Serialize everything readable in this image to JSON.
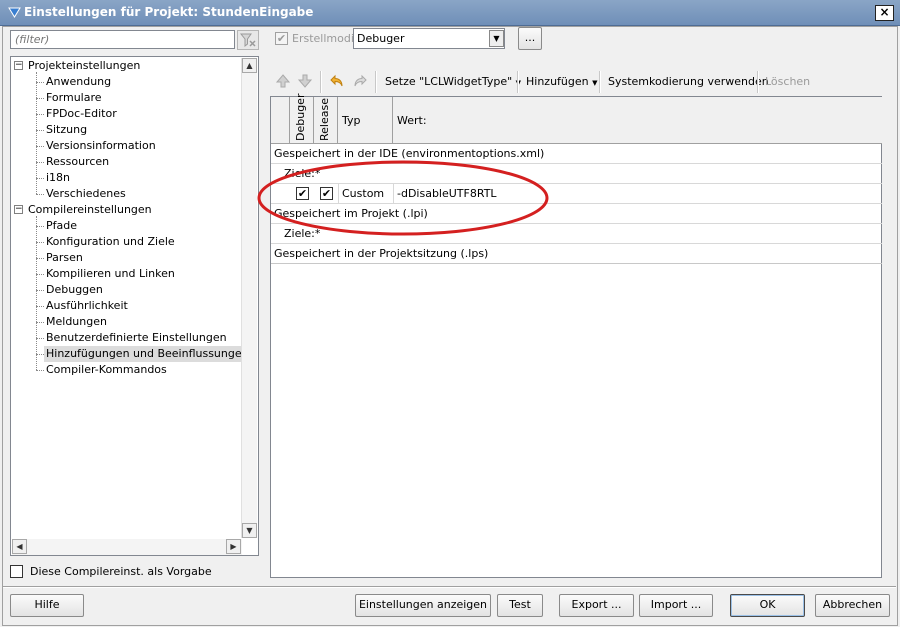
{
  "window": {
    "title": "Einstellungen für Projekt: StundenEingabe",
    "close": "×"
  },
  "filter": {
    "placeholder": "(filter)"
  },
  "top": {
    "erstellmodi_label": "Erstellmodi",
    "mode_value": "Debuger",
    "dots": "..."
  },
  "tree": {
    "group1": "Projekteinstellungen",
    "group1_items": [
      "Anwendung",
      "Formulare",
      "FPDoc-Editor",
      "Sitzung",
      "Versionsinformation",
      "Ressourcen",
      "i18n",
      "Verschiedenes"
    ],
    "group2": "Compilereinstellungen",
    "group2_items": [
      "Pfade",
      "Konfiguration und Ziele",
      "Parsen",
      "Kompilieren und Linken",
      "Debuggen",
      "Ausführlichkeit",
      "Meldungen",
      "Benutzerdefinierte Einstellungen",
      "Hinzufügungen und Beeinflussungen",
      "Compiler-Kommandos"
    ],
    "selected": "Hinzufügungen und Beeinflussungen"
  },
  "toolbar": {
    "setze": "Setze \"LCLWidgetType\"",
    "hinzufuegen": "Hinzufügen",
    "systemkodierung": "Systemkodierung verwenden",
    "loeschen": "Löschen"
  },
  "grid": {
    "headers": {
      "debuger": "Debuger",
      "release": "Release",
      "typ": "Typ",
      "wert": "Wert:"
    },
    "rows": {
      "ide": "Gespeichert in der IDE (environmentoptions.xml)",
      "ziele1": "Ziele:*",
      "custom_typ": "Custom",
      "custom_wert": "-dDisableUTF8RTL",
      "projekt": "Gespeichert im Projekt (.lpi)",
      "ziele2": "Ziele:*",
      "sitzung": "Gespeichert in der Projektsitzung (.lps)"
    }
  },
  "vorgabe": "Diese Compilereinst. als Vorgabe",
  "buttons": {
    "hilfe": "Hilfe",
    "anzeigen": "Einstellungen anzeigen",
    "test": "Test",
    "export": "Export ...",
    "import": "Import ...",
    "ok": "OK",
    "abbrechen": "Abbrechen"
  },
  "colors": {
    "annotation_ellipse": "#d42020",
    "titlebar": "#7896bd"
  }
}
